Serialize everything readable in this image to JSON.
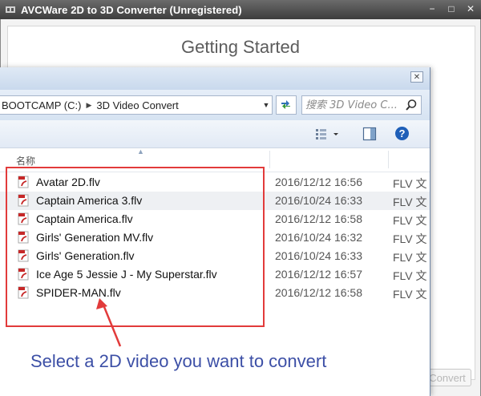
{
  "app": {
    "title": "AVCWare 2D to 3D Converter (Unregistered)",
    "heading": "Getting Started",
    "convert_label": "Convert"
  },
  "window_controls": [
    "−",
    "□",
    "✕"
  ],
  "dialog": {
    "breadcrumb": [
      "BOOTCAMP (C:)",
      "3D Video Convert"
    ],
    "search_placeholder": "搜索 3D Video C...",
    "column_name": "名称",
    "files": [
      {
        "name": "Avatar 2D.flv",
        "date": "2016/12/12 16:56",
        "type": "FLV 文"
      },
      {
        "name": "Captain America 3.flv",
        "date": "2016/10/24 16:33",
        "type": "FLV 文"
      },
      {
        "name": "Captain America.flv",
        "date": "2016/12/12 16:58",
        "type": "FLV 文"
      },
      {
        "name": "Girls' Generation MV.flv",
        "date": "2016/10/24 16:32",
        "type": "FLV 文"
      },
      {
        "name": "Girls' Generation.flv",
        "date": "2016/10/24 16:33",
        "type": "FLV 文"
      },
      {
        "name": "Ice Age 5  Jessie J  - My Superstar.flv",
        "date": "2016/12/12 16:57",
        "type": "FLV 文"
      },
      {
        "name": "SPIDER-MAN.flv",
        "date": "2016/12/12 16:58",
        "type": "FLV 文"
      }
    ]
  },
  "annotation": {
    "caption": "Select a 2D video you want to convert",
    "color": "#e23b3b"
  },
  "colors": {
    "accent_blue": "#3c4fa6",
    "flv_icon_red": "#c62828"
  },
  "icons": {
    "file": "flv-file-icon",
    "search": "magnifier-icon",
    "help": "help-icon"
  }
}
